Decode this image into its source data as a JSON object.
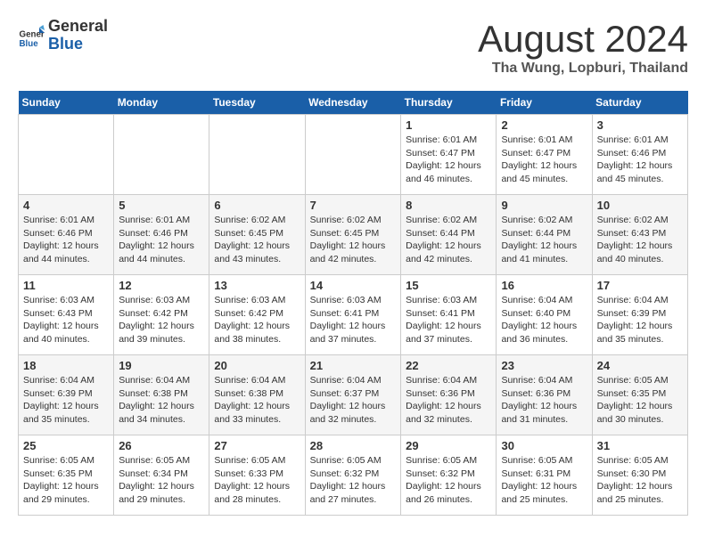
{
  "header": {
    "logo_line1": "General",
    "logo_line2": "Blue",
    "month_year": "August 2024",
    "location": "Tha Wung, Lopburi, Thailand"
  },
  "days_of_week": [
    "Sunday",
    "Monday",
    "Tuesday",
    "Wednesday",
    "Thursday",
    "Friday",
    "Saturday"
  ],
  "weeks": [
    [
      {
        "day": "",
        "info": ""
      },
      {
        "day": "",
        "info": ""
      },
      {
        "day": "",
        "info": ""
      },
      {
        "day": "",
        "info": ""
      },
      {
        "day": "1",
        "info": "Sunrise: 6:01 AM\nSunset: 6:47 PM\nDaylight: 12 hours\nand 46 minutes."
      },
      {
        "day": "2",
        "info": "Sunrise: 6:01 AM\nSunset: 6:47 PM\nDaylight: 12 hours\nand 45 minutes."
      },
      {
        "day": "3",
        "info": "Sunrise: 6:01 AM\nSunset: 6:46 PM\nDaylight: 12 hours\nand 45 minutes."
      }
    ],
    [
      {
        "day": "4",
        "info": "Sunrise: 6:01 AM\nSunset: 6:46 PM\nDaylight: 12 hours\nand 44 minutes."
      },
      {
        "day": "5",
        "info": "Sunrise: 6:01 AM\nSunset: 6:46 PM\nDaylight: 12 hours\nand 44 minutes."
      },
      {
        "day": "6",
        "info": "Sunrise: 6:02 AM\nSunset: 6:45 PM\nDaylight: 12 hours\nand 43 minutes."
      },
      {
        "day": "7",
        "info": "Sunrise: 6:02 AM\nSunset: 6:45 PM\nDaylight: 12 hours\nand 42 minutes."
      },
      {
        "day": "8",
        "info": "Sunrise: 6:02 AM\nSunset: 6:44 PM\nDaylight: 12 hours\nand 42 minutes."
      },
      {
        "day": "9",
        "info": "Sunrise: 6:02 AM\nSunset: 6:44 PM\nDaylight: 12 hours\nand 41 minutes."
      },
      {
        "day": "10",
        "info": "Sunrise: 6:02 AM\nSunset: 6:43 PM\nDaylight: 12 hours\nand 40 minutes."
      }
    ],
    [
      {
        "day": "11",
        "info": "Sunrise: 6:03 AM\nSunset: 6:43 PM\nDaylight: 12 hours\nand 40 minutes."
      },
      {
        "day": "12",
        "info": "Sunrise: 6:03 AM\nSunset: 6:42 PM\nDaylight: 12 hours\nand 39 minutes."
      },
      {
        "day": "13",
        "info": "Sunrise: 6:03 AM\nSunset: 6:42 PM\nDaylight: 12 hours\nand 38 minutes."
      },
      {
        "day": "14",
        "info": "Sunrise: 6:03 AM\nSunset: 6:41 PM\nDaylight: 12 hours\nand 37 minutes."
      },
      {
        "day": "15",
        "info": "Sunrise: 6:03 AM\nSunset: 6:41 PM\nDaylight: 12 hours\nand 37 minutes."
      },
      {
        "day": "16",
        "info": "Sunrise: 6:04 AM\nSunset: 6:40 PM\nDaylight: 12 hours\nand 36 minutes."
      },
      {
        "day": "17",
        "info": "Sunrise: 6:04 AM\nSunset: 6:39 PM\nDaylight: 12 hours\nand 35 minutes."
      }
    ],
    [
      {
        "day": "18",
        "info": "Sunrise: 6:04 AM\nSunset: 6:39 PM\nDaylight: 12 hours\nand 35 minutes."
      },
      {
        "day": "19",
        "info": "Sunrise: 6:04 AM\nSunset: 6:38 PM\nDaylight: 12 hours\nand 34 minutes."
      },
      {
        "day": "20",
        "info": "Sunrise: 6:04 AM\nSunset: 6:38 PM\nDaylight: 12 hours\nand 33 minutes."
      },
      {
        "day": "21",
        "info": "Sunrise: 6:04 AM\nSunset: 6:37 PM\nDaylight: 12 hours\nand 32 minutes."
      },
      {
        "day": "22",
        "info": "Sunrise: 6:04 AM\nSunset: 6:36 PM\nDaylight: 12 hours\nand 32 minutes."
      },
      {
        "day": "23",
        "info": "Sunrise: 6:04 AM\nSunset: 6:36 PM\nDaylight: 12 hours\nand 31 minutes."
      },
      {
        "day": "24",
        "info": "Sunrise: 6:05 AM\nSunset: 6:35 PM\nDaylight: 12 hours\nand 30 minutes."
      }
    ],
    [
      {
        "day": "25",
        "info": "Sunrise: 6:05 AM\nSunset: 6:35 PM\nDaylight: 12 hours\nand 29 minutes."
      },
      {
        "day": "26",
        "info": "Sunrise: 6:05 AM\nSunset: 6:34 PM\nDaylight: 12 hours\nand 29 minutes."
      },
      {
        "day": "27",
        "info": "Sunrise: 6:05 AM\nSunset: 6:33 PM\nDaylight: 12 hours\nand 28 minutes."
      },
      {
        "day": "28",
        "info": "Sunrise: 6:05 AM\nSunset: 6:32 PM\nDaylight: 12 hours\nand 27 minutes."
      },
      {
        "day": "29",
        "info": "Sunrise: 6:05 AM\nSunset: 6:32 PM\nDaylight: 12 hours\nand 26 minutes."
      },
      {
        "day": "30",
        "info": "Sunrise: 6:05 AM\nSunset: 6:31 PM\nDaylight: 12 hours\nand 25 minutes."
      },
      {
        "day": "31",
        "info": "Sunrise: 6:05 AM\nSunset: 6:30 PM\nDaylight: 12 hours\nand 25 minutes."
      }
    ]
  ]
}
